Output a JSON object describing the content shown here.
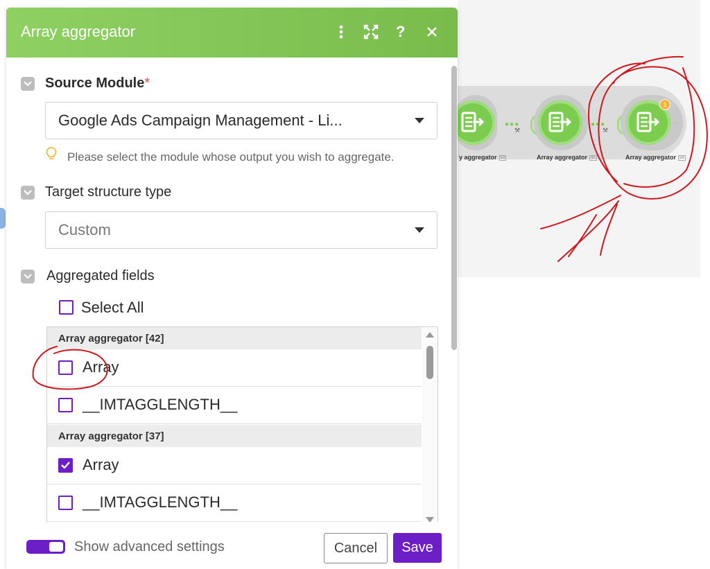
{
  "modal": {
    "title": "Array aggregator",
    "icons": [
      "more-vertical-icon",
      "expand-icon",
      "help-icon",
      "close-icon"
    ]
  },
  "source_module": {
    "label": "Source Module",
    "required_marker": "*",
    "value": "Google Ads Campaign Management - Li...",
    "hint": "Please select the module whose output you wish to aggregate."
  },
  "target_structure": {
    "label": "Target structure type",
    "value": "Custom"
  },
  "aggregated_fields": {
    "label": "Aggregated fields",
    "select_all_label": "Select All",
    "select_all_checked": false,
    "groups": [
      {
        "header": "Array aggregator [42]",
        "items": [
          {
            "label": "Array",
            "checked": false
          },
          {
            "label": "__IMTAGGLENGTH__",
            "checked": false
          }
        ]
      },
      {
        "header": "Array aggregator [37]",
        "items": [
          {
            "label": "Array",
            "checked": true
          },
          {
            "label": "__IMTAGGLENGTH__",
            "checked": false
          }
        ]
      }
    ]
  },
  "footer": {
    "advanced_label": "Show advanced settings",
    "advanced_enabled": true,
    "cancel_label": "Cancel",
    "save_label": "Save"
  },
  "scenario": {
    "nodes": [
      {
        "label": "y aggregator",
        "num": "53"
      },
      {
        "label": "Array aggregator",
        "num": "42"
      },
      {
        "label": "Array aggregator",
        "num": "54",
        "badge": "1"
      }
    ]
  },
  "colors": {
    "header_green": "#7fc254",
    "accent_purple": "#6d1fc7",
    "node_green": "#7ccc4f",
    "annotation_red": "#d0161c"
  }
}
